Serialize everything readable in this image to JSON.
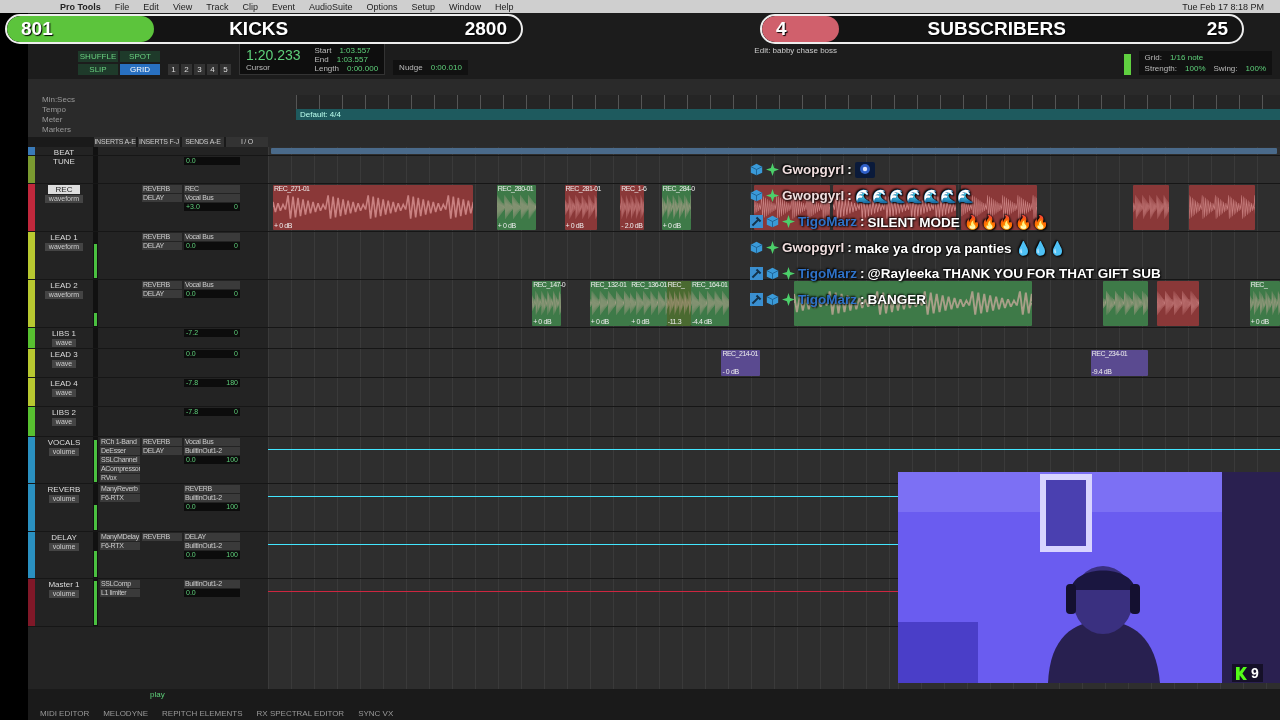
{
  "menu_bar": {
    "items": [
      "Pro Tools",
      "File",
      "Edit",
      "View",
      "Track",
      "Clip",
      "Event",
      "AudioSuite",
      "Options",
      "Setup",
      "Window",
      "Help"
    ],
    "clock": "Tue Feb 17  8:18 PM"
  },
  "goals": [
    {
      "current": "801",
      "label": "KICKS",
      "target": "2800",
      "level": 0.286,
      "color": "#5cc43c"
    },
    {
      "current": "4",
      "label": "SUBSCRIBERS",
      "target": "25",
      "level": 0.16,
      "color": "#d0606c"
    }
  ],
  "window": {
    "title": "Edit: babby chase boss"
  },
  "toolbar": {
    "modes": [
      {
        "label": "SHUFFLE",
        "selected": false
      },
      {
        "label": "SPOT",
        "selected": false
      },
      {
        "label": "SLIP",
        "selected": false
      },
      {
        "label": "GRID",
        "selected": true
      }
    ],
    "zoom_presets": [
      "1",
      "2",
      "3",
      "4",
      "5"
    ],
    "counter": "1:20.233",
    "cursor_label": "Cursor",
    "selection": [
      {
        "label": "Start",
        "value": "1:03.557"
      },
      {
        "label": "End",
        "value": "1:03.557"
      },
      {
        "label": "Length",
        "value": "0:00.000"
      }
    ],
    "nudge_label": "Nudge",
    "nudge_value": "0:00.010",
    "grid_label": "Grid:",
    "grid_value": "1/16 note",
    "strength_label": "Strength:",
    "strength_value": "100%",
    "swing_label": "Swing:",
    "swing_value": "100%"
  },
  "rulers": [
    "Min:Secs",
    "Tempo",
    "Meter",
    "Markers"
  ],
  "meter_marker": "Default: 4/4",
  "columns": [
    "INSERTS A-E",
    "INSERTS F-J",
    "SENDS A-E",
    "I / O"
  ],
  "tracks": [
    {
      "name": "BEAT",
      "color": "#3a7ab8",
      "clips": [
        {
          "color": "#4a6a8a"
        }
      ]
    },
    {
      "name": "TUNE",
      "color": "#7a9a30",
      "vol": "0.0"
    },
    {
      "name": "REC",
      "color": "#c0283c",
      "view": "waveform",
      "armed": true,
      "sends": [
        "REVERB",
        "DELAY"
      ],
      "io": [
        "REC",
        "Vocal Bus"
      ],
      "vol": "+3.0",
      "pan": "0",
      "clips": [
        {
          "name": "REC_271-01",
          "gain": "+ 0 dB",
          "color": "#8a3838"
        },
        {
          "name": "REC_280-01",
          "gain": "+ 0 dB",
          "color": "#3e7a48"
        },
        {
          "name": "REC_281-01",
          "gain": "+ 0 dB",
          "color": "#8a3838"
        },
        {
          "name": "REC_1-6",
          "gain": "- 2.0 dB",
          "color": "#8a3838"
        },
        {
          "name": "REC_284-0",
          "gain": "+ 0 dB",
          "color": "#3e7a48"
        },
        {
          "color": "#8a3838"
        },
        {
          "color": "#8a3838"
        },
        {
          "color": "#8a3838"
        },
        {
          "color": "#8a3838"
        },
        {
          "color": "#8a3838"
        }
      ]
    },
    {
      "name": "LEAD 1",
      "color": "#b8c830",
      "view": "waveform",
      "armed": false,
      "sends": [
        "REVERB",
        "DELAY"
      ],
      "io": [
        "Vocal Bus"
      ],
      "vol": "0.0",
      "pan": "0",
      "level": 0.75
    },
    {
      "name": "LEAD 2",
      "color": "#b8c830",
      "view": "waveform",
      "armed": false,
      "sends": [
        "REVERB",
        "DELAY"
      ],
      "io": [
        "Vocal Bus"
      ],
      "vol": "0.0",
      "pan": "0",
      "level": 0.3,
      "clips": [
        {
          "name": "REC_147-0",
          "gain": "+ 0 dB",
          "color": "#3e7a48"
        },
        {
          "name": "REC_132-01",
          "gain": "+ 0 dB",
          "color": "#3e7a48"
        },
        {
          "name": "REC_136-01",
          "gain": "+ 0 dB",
          "color": "#3e7a48"
        },
        {
          "name": "REC_",
          "gain": "-11.3",
          "color": "#4a6a30"
        },
        {
          "name": "REC_164-01",
          "gain": "-4.4 dB",
          "color": "#3e7a48"
        },
        {
          "color": "#3e7a48"
        },
        {
          "color": "#3e7a48"
        },
        {
          "color": "#8a3838"
        },
        {
          "name": "REC_",
          "gain": "+ 0 dB",
          "color": "#3e7a48"
        }
      ]
    },
    {
      "name": "LIBS 1",
      "color": "#58c030",
      "view": "wave",
      "vol": "-7.2",
      "pan": "0"
    },
    {
      "name": "LEAD 3",
      "color": "#b8c830",
      "view": "wave",
      "vol": "0.0",
      "pan": "0",
      "clips": [
        {
          "name": "REC_214-01",
          "gain": "- 0 dB",
          "color": "#5a4a90"
        },
        {
          "name": "REC_234-01",
          "gain": "-9.4 dB",
          "color": "#5a4a90"
        }
      ]
    },
    {
      "name": "LEAD 4",
      "color": "#b8c830",
      "view": "wave",
      "vol": "-7.8",
      "pan": "180"
    },
    {
      "name": "LIBS 2",
      "color": "#58c030",
      "view": "wave",
      "vol": "-7.8",
      "pan": "0"
    },
    {
      "name": "VOCALS",
      "color": "#2a90c0",
      "view": "volume",
      "inserts": [
        "RCh 1-Band",
        "DeEsser",
        "SSLChannel",
        "ACompressor",
        "RVox"
      ],
      "sends": [
        "REVERB",
        "DELAY"
      ],
      "io": [
        "Vocal Bus",
        "BuiltInOut1-2"
      ],
      "vol": "0.0",
      "pan": "100",
      "level": 0.95,
      "automation": true
    },
    {
      "name": "REVERB",
      "color": "#2a90c0",
      "view": "volume",
      "inserts": [
        "ManyReverb",
        "F6-RTX"
      ],
      "io": [
        "REVERB",
        "BuiltInOut1-2"
      ],
      "vol": "0.0",
      "pan": "100",
      "level": 0.55,
      "automation": true
    },
    {
      "name": "DELAY",
      "color": "#2a90c0",
      "view": "volume",
      "inserts": [
        "ManyMDelay",
        "F6-RTX"
      ],
      "sends": [
        "REVERB"
      ],
      "io": [
        "DELAY",
        "BuiltInOut1-2"
      ],
      "vol": "0.0",
      "pan": "100",
      "level": 0.6,
      "automation": true
    },
    {
      "name": "Master 1",
      "color": "#801828",
      "view": "volume",
      "inserts": [
        "SSLComp",
        "L1 limiter"
      ],
      "io": [
        "BuiltInOut1-2"
      ],
      "vol": "0.0",
      "level": 0.97,
      "automation": true
    }
  ],
  "chat": [
    {
      "user": "Gwopgyrl",
      "color": "#f0dede",
      "badges": [
        {
          "kind": "cube"
        },
        {
          "kind": "sparkle"
        }
      ],
      "emote": true
    },
    {
      "user": "Gwopgyrl",
      "color": "#f0dede",
      "badges": [
        {
          "kind": "cube"
        },
        {
          "kind": "sparkle"
        }
      ],
      "text": "🌊🌊🌊🌊🌊🌊🌊"
    },
    {
      "user": "TigoMarz",
      "color": "#2f72c8",
      "badges": [
        {
          "kind": "hammer"
        },
        {
          "kind": "cube"
        },
        {
          "kind": "sparkle"
        }
      ],
      "text": "SILENT MODE 🔥🔥🔥🔥🔥"
    },
    {
      "user": "Gwopgyrl",
      "color": "#f0dede",
      "badges": [
        {
          "kind": "cube"
        },
        {
          "kind": "sparkle"
        }
      ],
      "text": "make ya drop ya panties 💧💧💧"
    },
    {
      "user": "TigoMarz",
      "color": "#2f72c8",
      "badges": [
        {
          "kind": "hammer"
        },
        {
          "kind": "cube"
        },
        {
          "kind": "sparkle"
        }
      ],
      "text": "@Rayleeka THANK YOU FOR THAT GIFT SUB"
    },
    {
      "user": "TigoMarz",
      "color": "#2f72c8",
      "badges": [
        {
          "kind": "hammer"
        },
        {
          "kind": "cube"
        },
        {
          "kind": "sparkle"
        }
      ],
      "text": "BANGER"
    }
  ],
  "separator": ":",
  "webcam": {
    "kind": "picture"
  },
  "viewer_badge": {
    "count": "9"
  },
  "transport_hint": "play",
  "bottom_tabs": [
    "MIDI EDITOR",
    "MELODYNE",
    "REPITCH ELEMENTS",
    "RX SPECTRAL EDITOR",
    "SYNC VX"
  ]
}
